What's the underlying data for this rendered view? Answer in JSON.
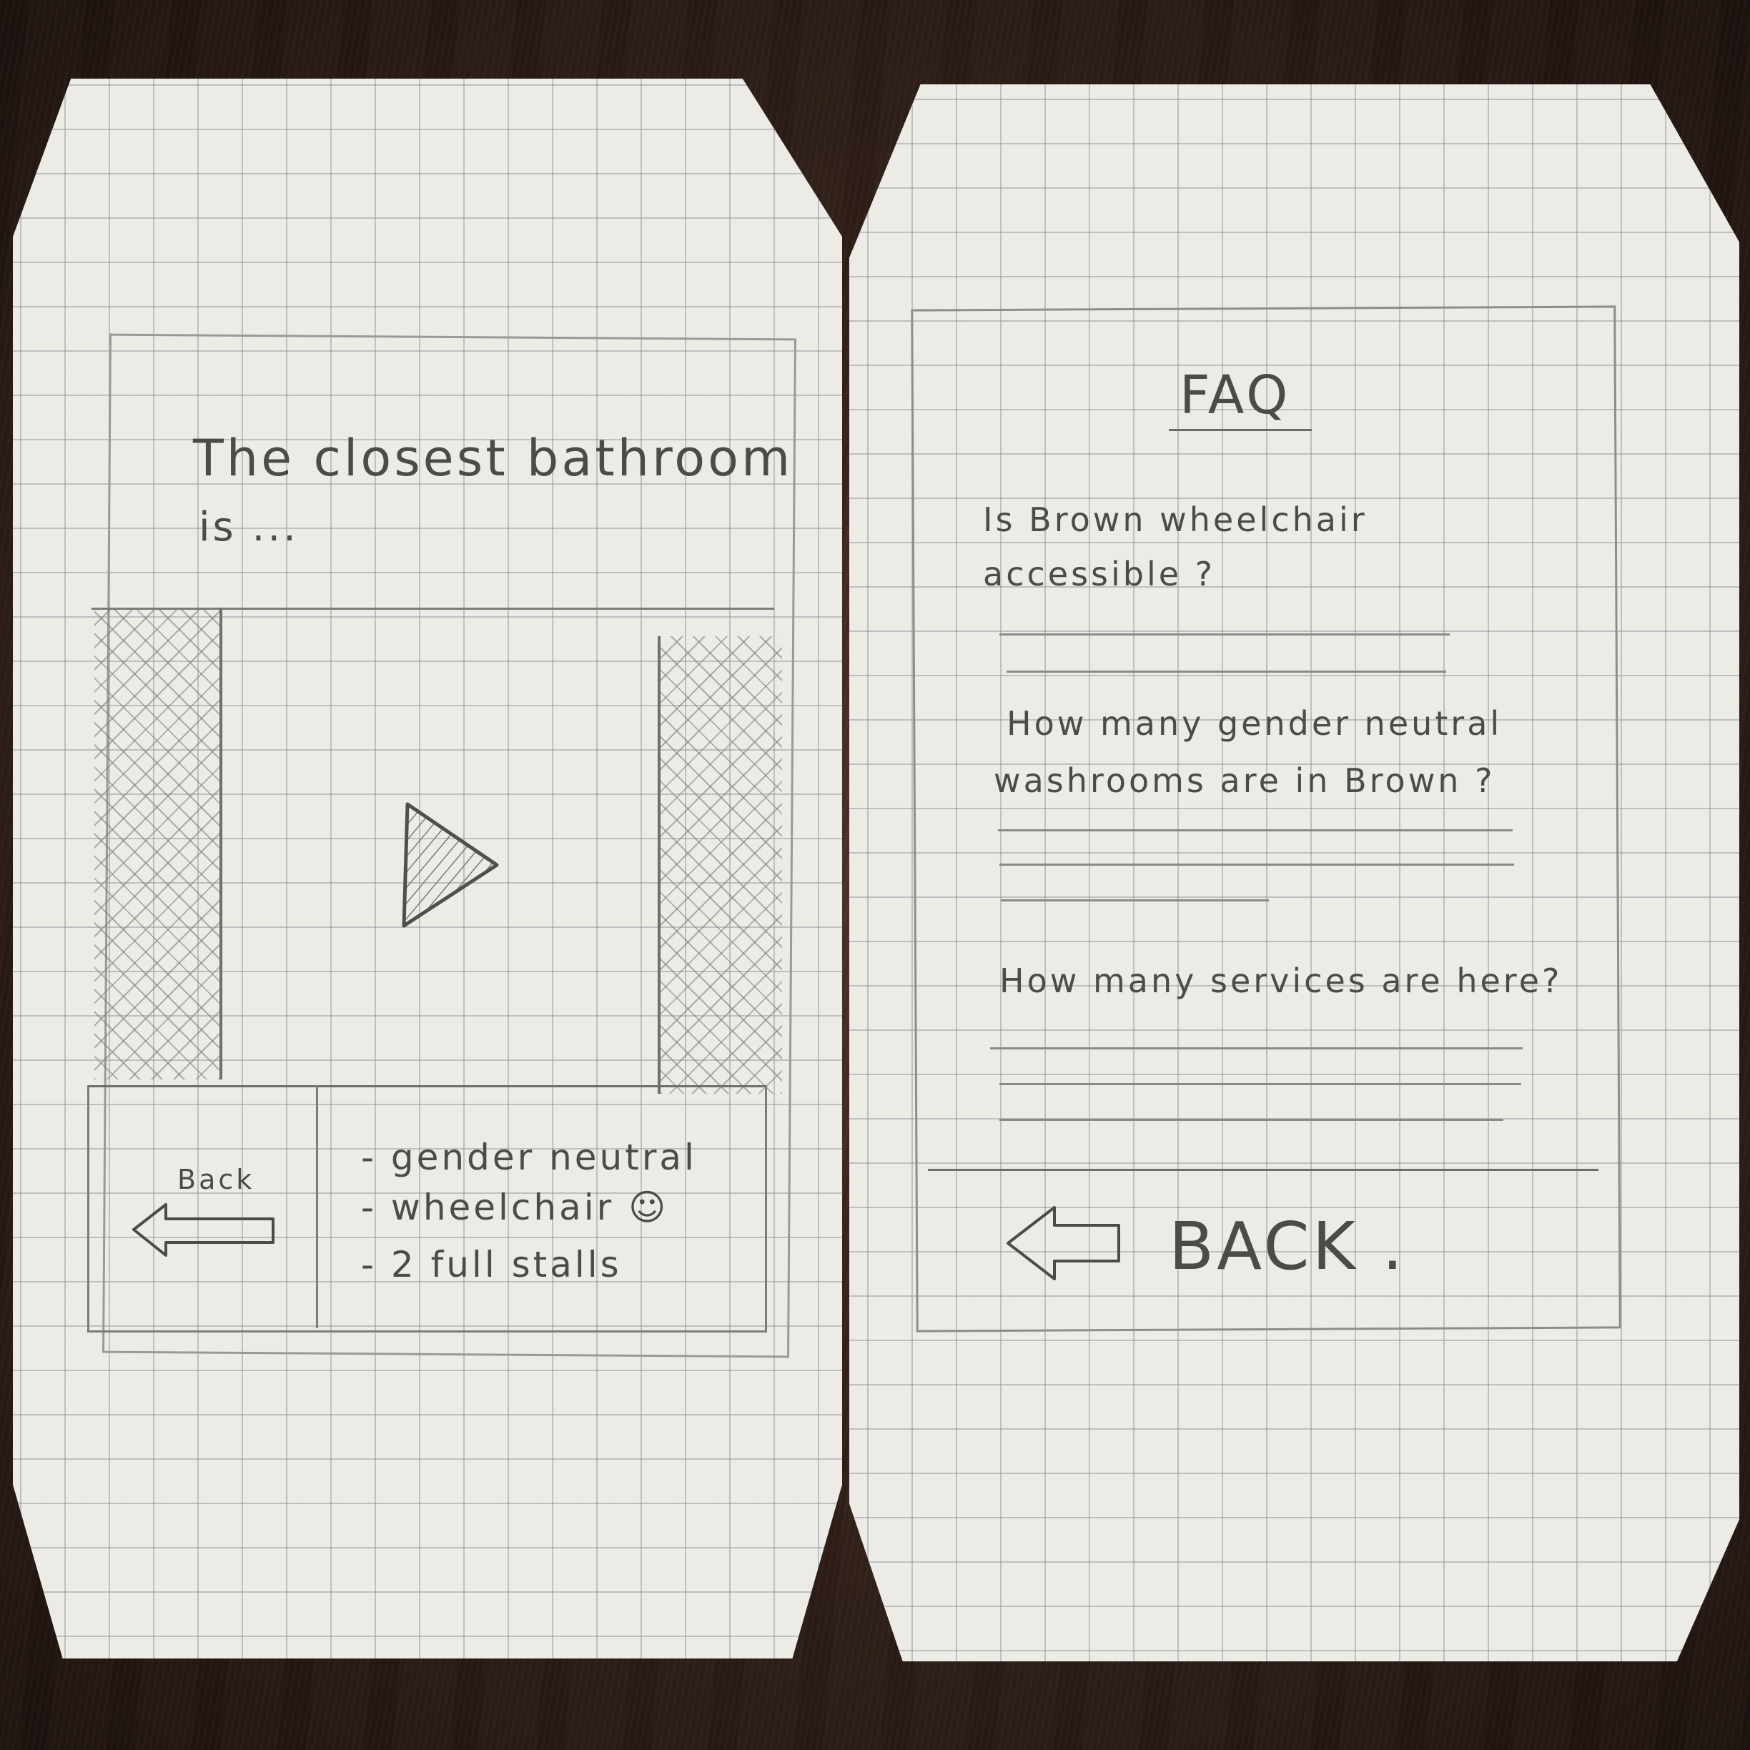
{
  "left_screen": {
    "title_line1": "The closest bathroom",
    "title_line2": "is ...",
    "back_label": "Back",
    "features": [
      "- gender neutral",
      "- wheelchair ☺",
      "- 2 full stalls"
    ]
  },
  "right_screen": {
    "title": "FAQ",
    "faq": [
      {
        "q_line1": "Is  Brown  wheelchair",
        "q_line2": "accessible ?"
      },
      {
        "q_line1": "How  many  gender  neutral",
        "q_line2": "washrooms   are  in  Brown ?"
      },
      {
        "q_line1": "How  many  services  are  here?",
        "q_line2": ""
      }
    ],
    "back_label": "BACK ."
  },
  "icons": [
    "left-arrow-icon",
    "play-triangle-icon",
    "smiley-icon"
  ]
}
